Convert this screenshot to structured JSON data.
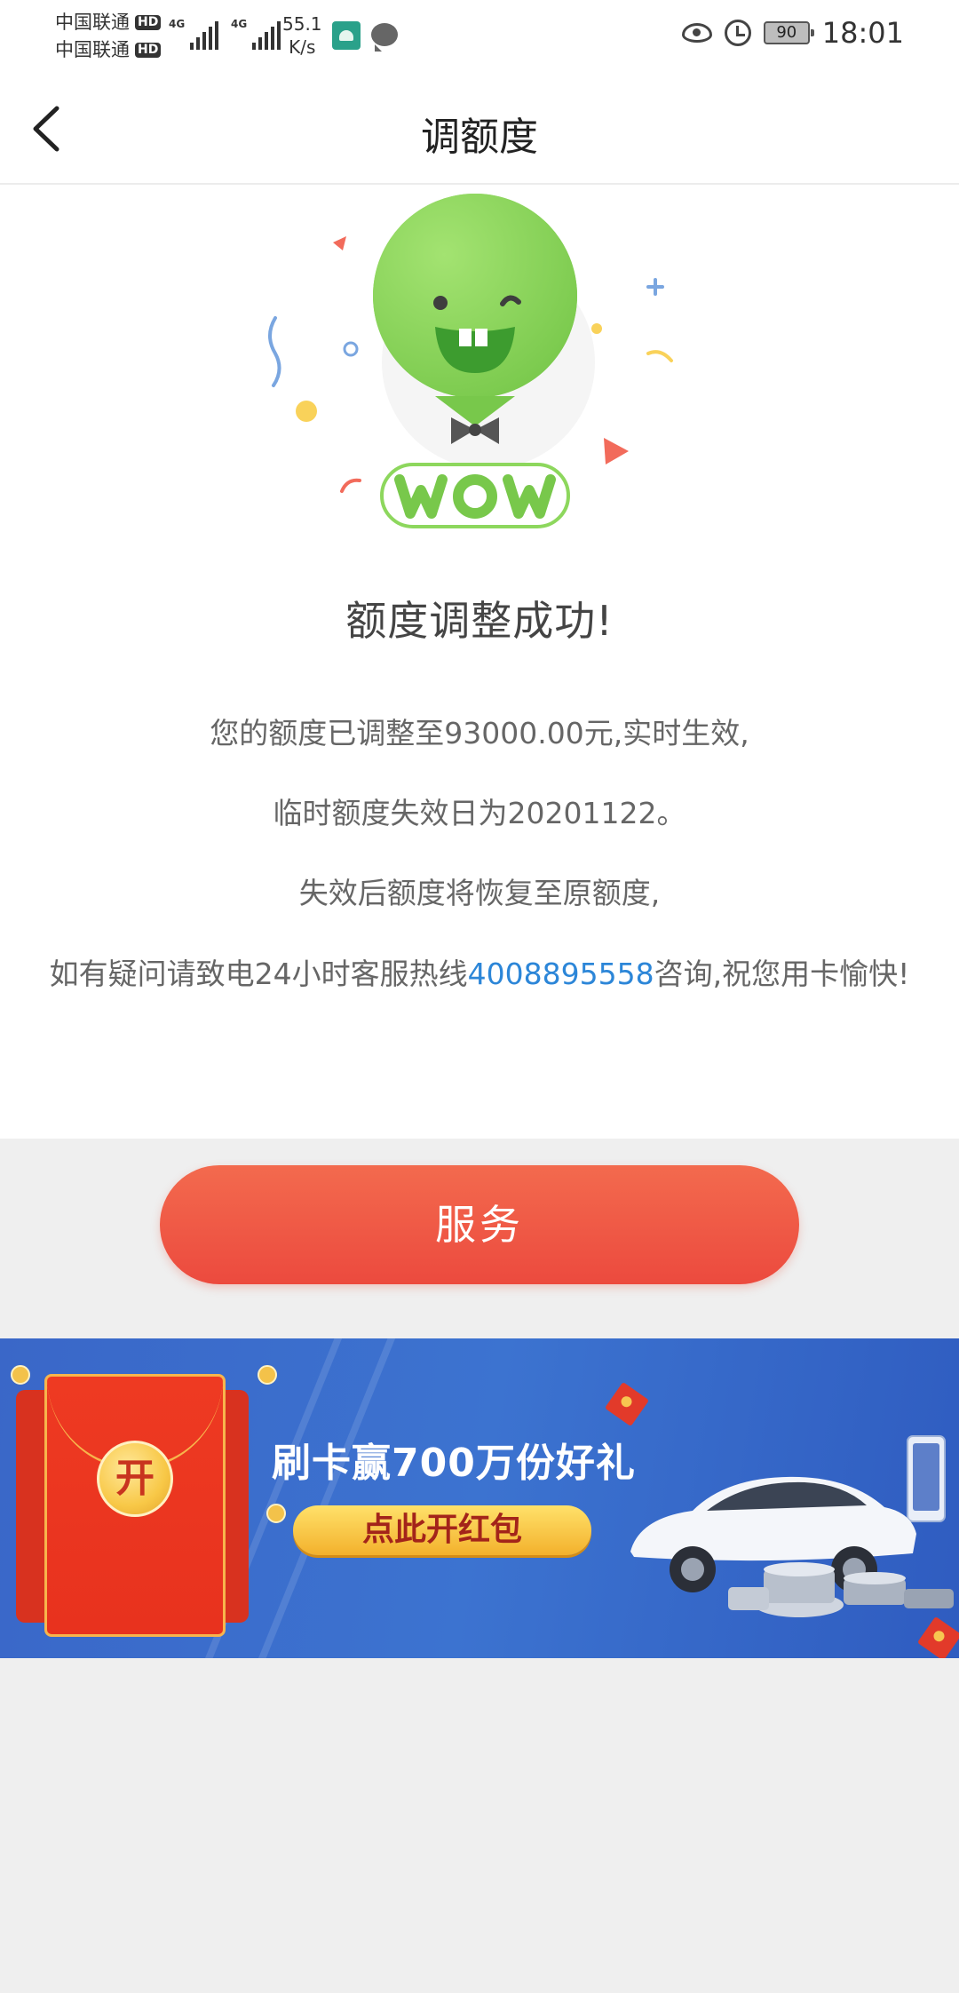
{
  "status_bar": {
    "carrier_1": "中国联通",
    "carrier_2": "中国联通",
    "hd_badge": "HD",
    "network_1": "4G",
    "network_2": "4G",
    "speed_value": "55.1",
    "speed_unit": "K/s",
    "battery": "90",
    "time": "18:01"
  },
  "header": {
    "title": "调额度"
  },
  "result": {
    "title": "额度调整成功!",
    "line_1": "您的额度已调整至93000.00元,实时生效,",
    "line_2": "临时额度失效日为20201122。",
    "line_3": "失效后额度将恢复至原额度,",
    "line_4_prefix": "如有疑问请致电24小时客服热线",
    "hotline": "4008895558",
    "line_4_suffix": "咨询,祝您用卡愉快!"
  },
  "service_button": {
    "label": "服务"
  },
  "banner": {
    "seal_text": "开",
    "headline": "刷卡赢700万份好礼",
    "cta": "点此开红包"
  },
  "colors": {
    "accent_red": "#ec4a3e",
    "link_blue": "#2c86d8",
    "banner_blue": "#3a67c8"
  }
}
